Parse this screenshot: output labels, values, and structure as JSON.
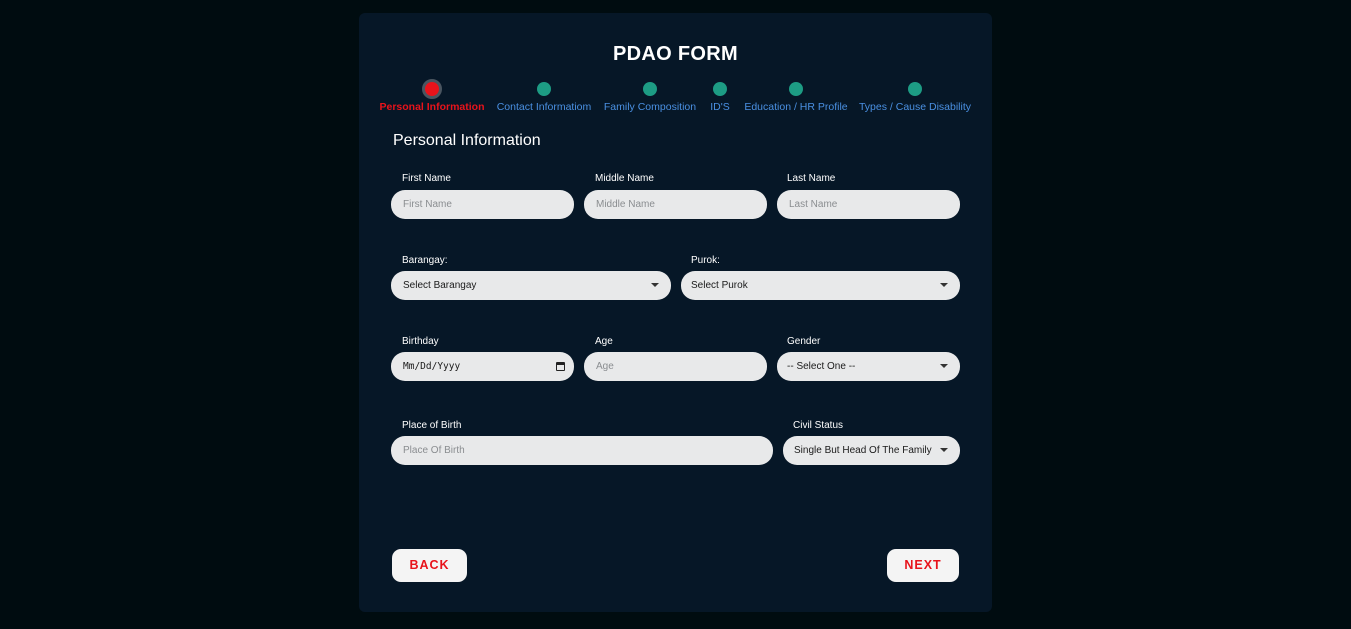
{
  "title": "PDAO FORM",
  "steps": [
    {
      "label": "Personal Information",
      "active": true
    },
    {
      "label": "Contact Informatiom",
      "active": false
    },
    {
      "label": "Family Composition",
      "active": false
    },
    {
      "label": "ID'S",
      "active": false
    },
    {
      "label": "Education / HR Profile",
      "active": false
    },
    {
      "label": "Types / Cause Disability",
      "active": false
    }
  ],
  "section_title": "Personal Information",
  "fields": {
    "first_name": {
      "label": "First Name",
      "placeholder": "First Name"
    },
    "middle_name": {
      "label": "Middle Name",
      "placeholder": "Middle Name"
    },
    "last_name": {
      "label": "Last Name",
      "placeholder": "Last Name"
    },
    "barangay": {
      "label": "Barangay:",
      "value": "Select Barangay"
    },
    "purok": {
      "label": "Purok:",
      "value": "Select Purok"
    },
    "birthday": {
      "label": "Birthday",
      "value": "Mm/Dd/Yyyy"
    },
    "age": {
      "label": "Age",
      "placeholder": "Age"
    },
    "gender": {
      "label": "Gender",
      "value": "-- Select One --"
    },
    "place_of_birth": {
      "label": "Place of Birth",
      "placeholder": "Place Of Birth"
    },
    "civil_status": {
      "label": "Civil Status",
      "value": "Single But Head Of The Family"
    }
  },
  "buttons": {
    "back": "BACK",
    "next": "NEXT"
  },
  "colors": {
    "background": "#000c10",
    "card": "#061727",
    "accent_red": "#e8131b",
    "step_teal": "#1d9c84",
    "step_label_blue": "#4a90e2",
    "input_bg": "#e8e9ea"
  }
}
